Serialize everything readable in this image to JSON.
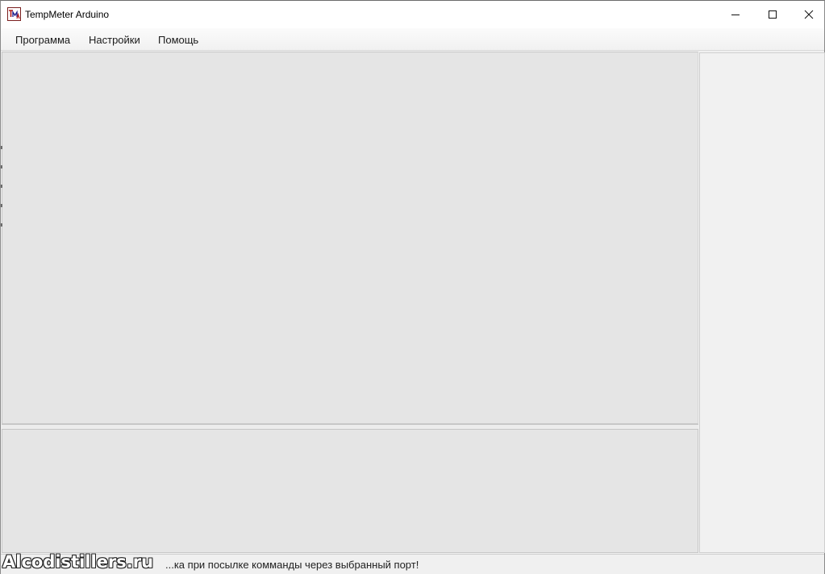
{
  "window": {
    "title": "TempMeter Arduino",
    "icon": "tempmeter-app-icon"
  },
  "title_buttons": {
    "minimize_icon": "minimize-icon",
    "maximize_icon": "maximize-icon",
    "close_icon": "close-icon"
  },
  "menu": {
    "items": [
      {
        "label": "Программа"
      },
      {
        "label": "Настройки"
      },
      {
        "label": "Помощь"
      }
    ]
  },
  "status": {
    "text": "...ка при посылке комманды через выбранный порт!"
  },
  "watermark": {
    "text": "Alcodistillers.ru"
  },
  "colors": {
    "panel_bg": "#e5e5e5",
    "right_panel_bg": "#f1f1f1",
    "titlebar_bg": "#ffffff",
    "icon_accent": "#b01818"
  }
}
